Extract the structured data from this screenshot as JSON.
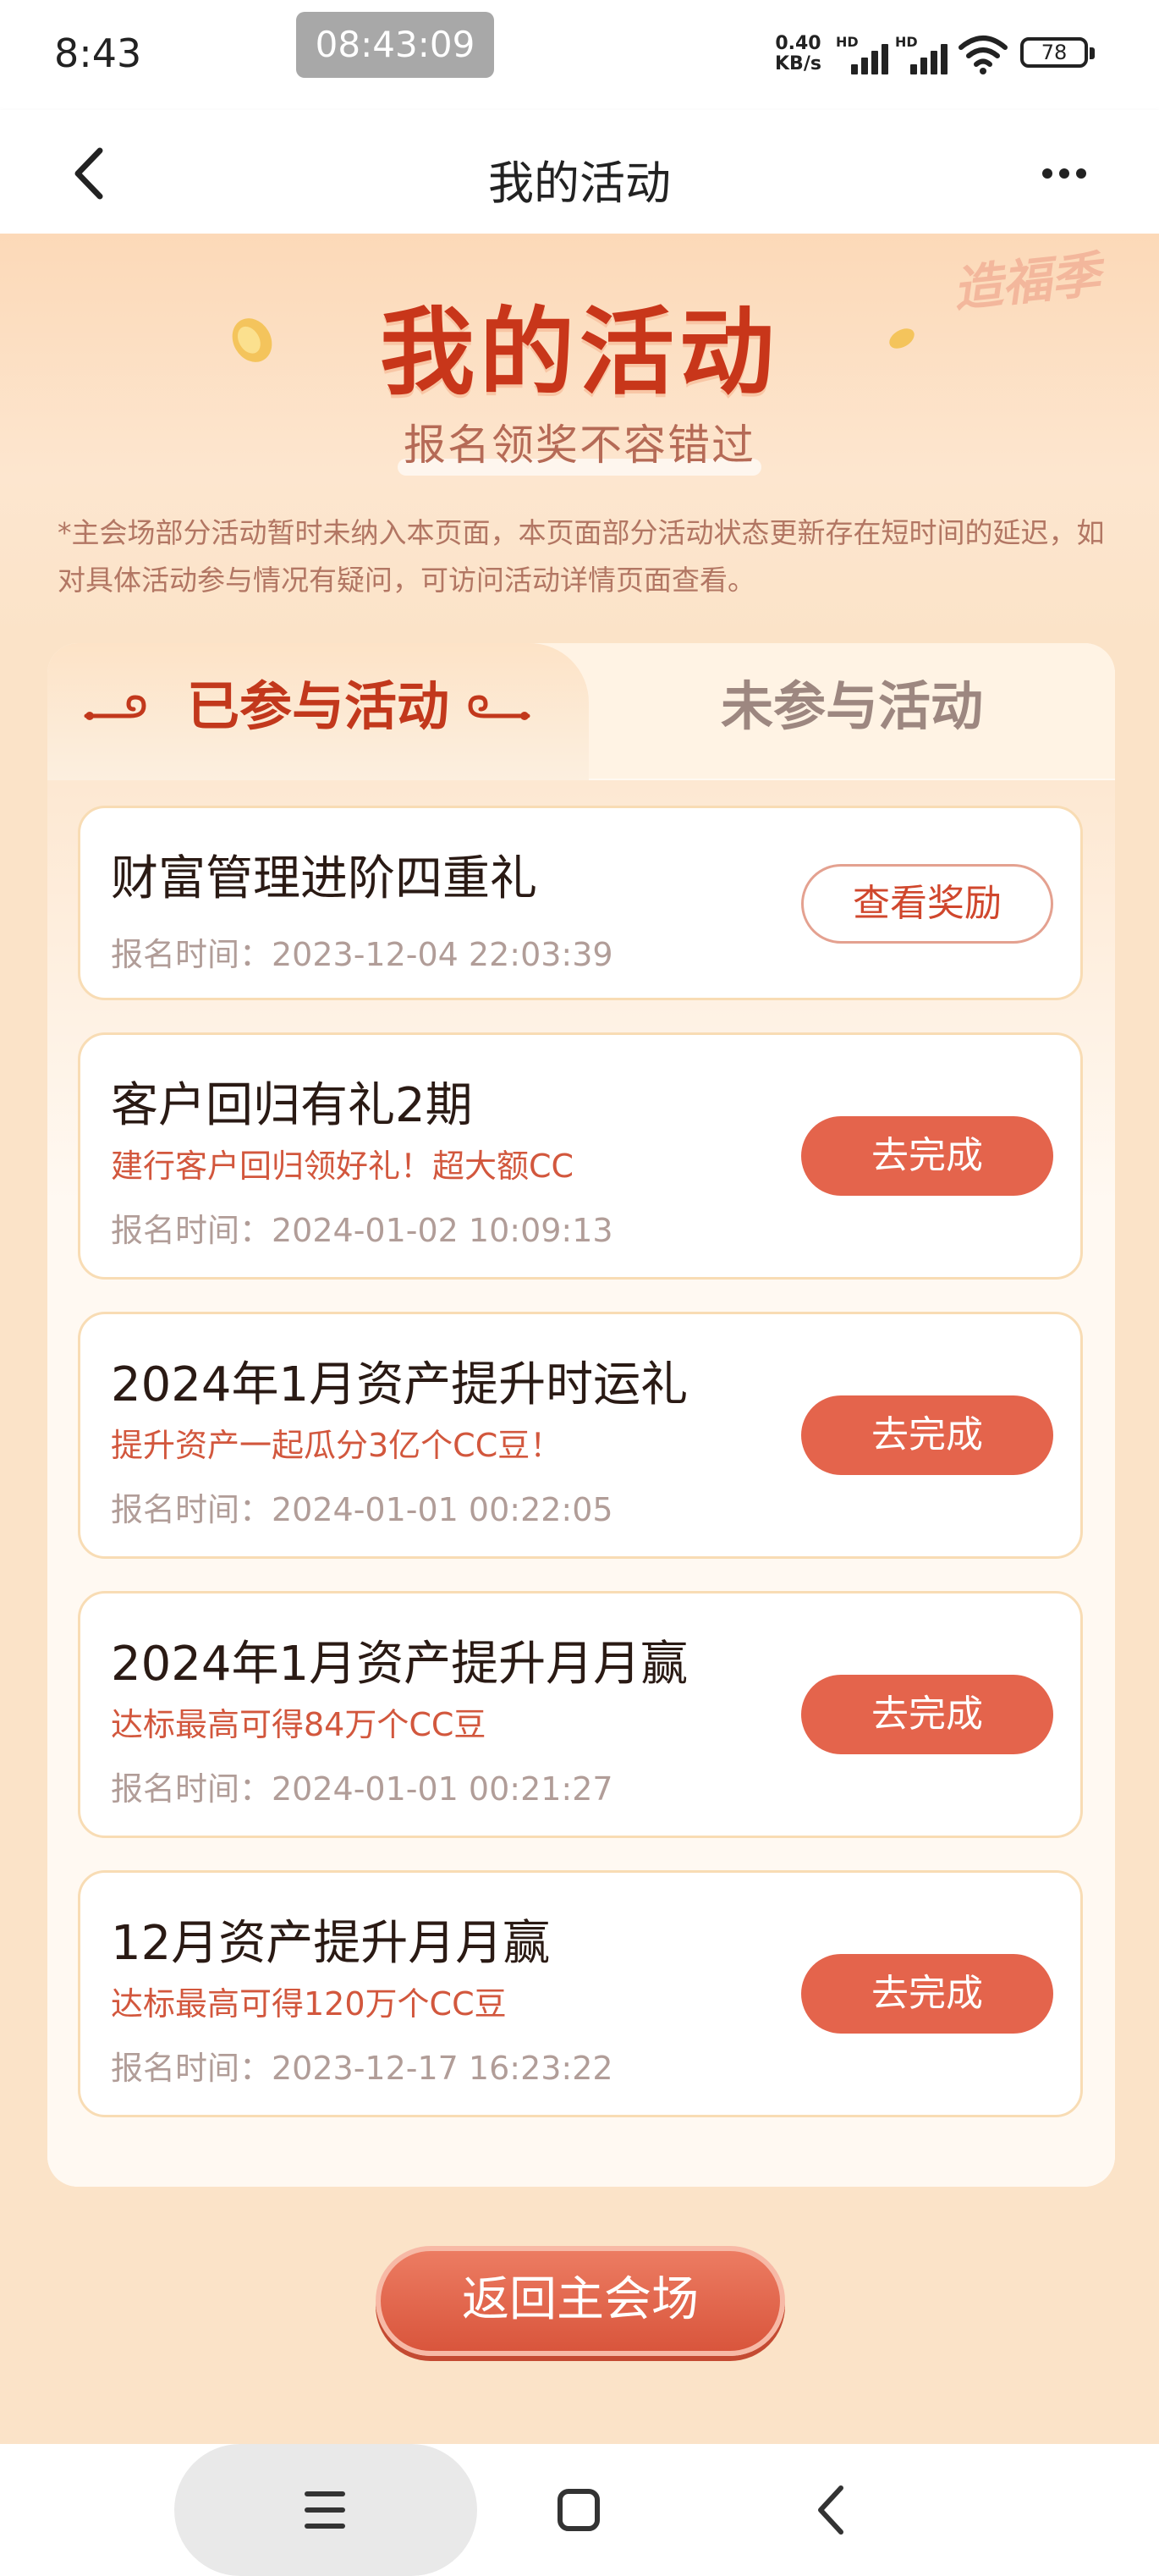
{
  "status_bar": {
    "time": "8:43",
    "recording_time": "08:43:09",
    "net_speed_value": "0.40",
    "net_speed_unit": "KB/s",
    "signal_label": "HD",
    "battery": "78"
  },
  "nav": {
    "title": "我的活动"
  },
  "hero": {
    "logo_text": "造福季",
    "title": "我的活动",
    "subtitle": "报名领奖不容错过",
    "disclaimer": "*主会场部分活动暂时未纳入本页面，本页面部分活动状态更新存在短时间的延迟，如对具体活动参与情况有疑问，可访问活动详情页面查看。"
  },
  "tabs": {
    "active": "已参与活动",
    "inactive": "未参与活动"
  },
  "activities": [
    {
      "title": "财富管理进阶四重礼",
      "desc": "",
      "time": "报名时间：2023-12-04 22:03:39",
      "button": "查看奖励"
    },
    {
      "title": "客户回归有礼2期",
      "desc": "建行客户回归领好礼！超大额CC",
      "time": "报名时间：2024-01-02 10:09:13",
      "button": "去完成"
    },
    {
      "title": "2024年1月资产提升时运礼",
      "desc": "提升资产一起瓜分3亿个CC豆！",
      "time": "报名时间：2024-01-01 00:22:05",
      "button": "去完成"
    },
    {
      "title": "2024年1月资产提升月月赢",
      "desc": "达标最高可得84万个CC豆",
      "time": "报名时间：2024-01-01 00:21:27",
      "button": "去完成"
    },
    {
      "title": "12月资产提升月月赢",
      "desc": "达标最高可得120万个CC豆",
      "time": "报名时间：2023-12-17 16:23:22",
      "button": "去完成"
    }
  ],
  "return_button": "返回主会场",
  "colors": {
    "accent": "#e4644c",
    "title_red": "#c8361a",
    "background": "#fbe3c8"
  }
}
